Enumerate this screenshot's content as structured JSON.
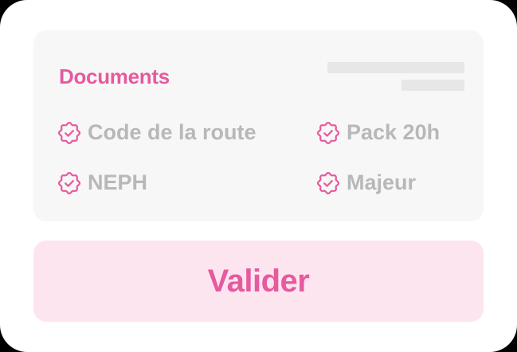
{
  "colors": {
    "accent": "#e65a9e",
    "button_bg": "#fde5f0",
    "muted_text": "#b8b8b8",
    "panel_bg": "#f7f7f7"
  },
  "documents": {
    "title": "Documents",
    "items": [
      {
        "label": "Code de la route",
        "icon": "badge-check-icon"
      },
      {
        "label": "Pack 20h",
        "icon": "badge-check-icon"
      },
      {
        "label": "NEPH",
        "icon": "badge-check-icon"
      },
      {
        "label": "Majeur",
        "icon": "badge-check-icon"
      }
    ]
  },
  "actions": {
    "validate_label": "Valider"
  }
}
